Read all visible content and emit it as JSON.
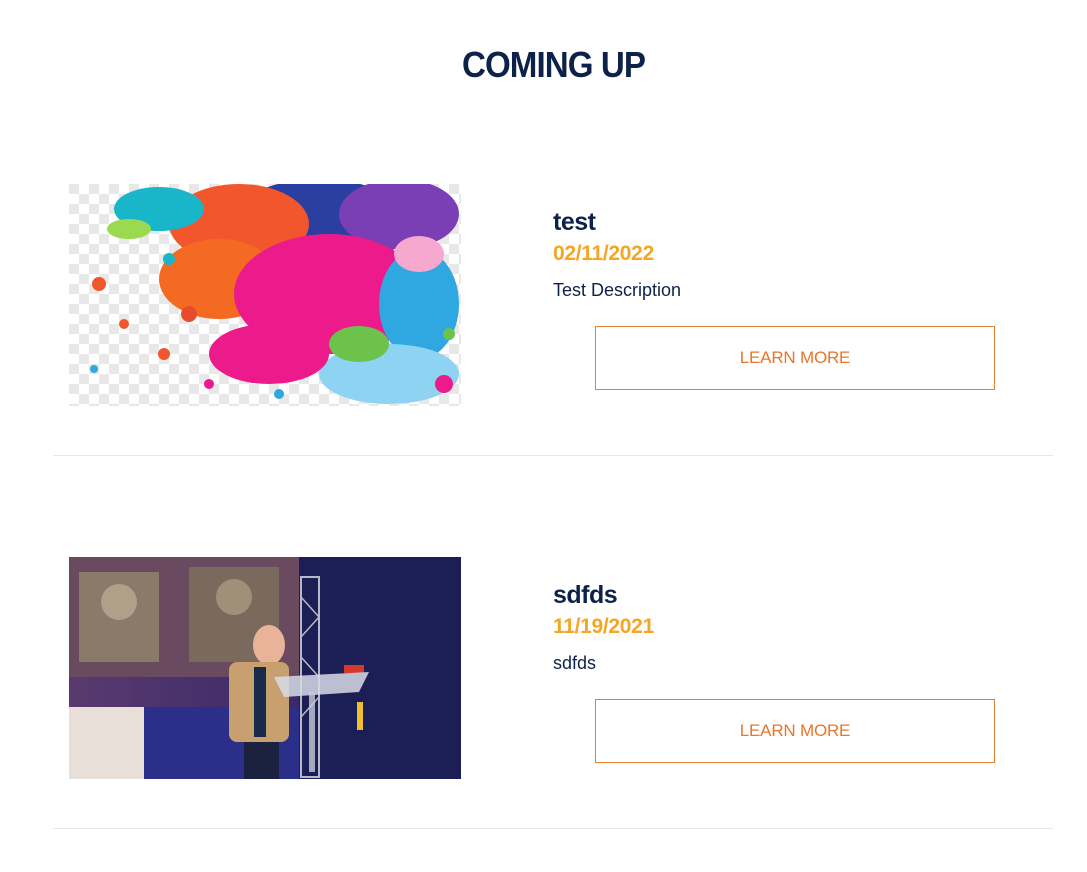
{
  "section": {
    "title": "COMING UP"
  },
  "events": [
    {
      "title": "test",
      "date": "02/11/2022",
      "description": "Test Description",
      "button_label": "LEARN MORE",
      "image": "paint-splatter-image"
    },
    {
      "title": "sdfds",
      "date": "11/19/2021",
      "description": "sdfds",
      "button_label": "LEARN MORE",
      "image": "speaker-at-podium-image"
    }
  ],
  "colors": {
    "title": "#0d2248",
    "date": "#f5a623",
    "button_border": "#e8812f",
    "button_text": "#e8762c",
    "divider": "#e6e6e6"
  }
}
